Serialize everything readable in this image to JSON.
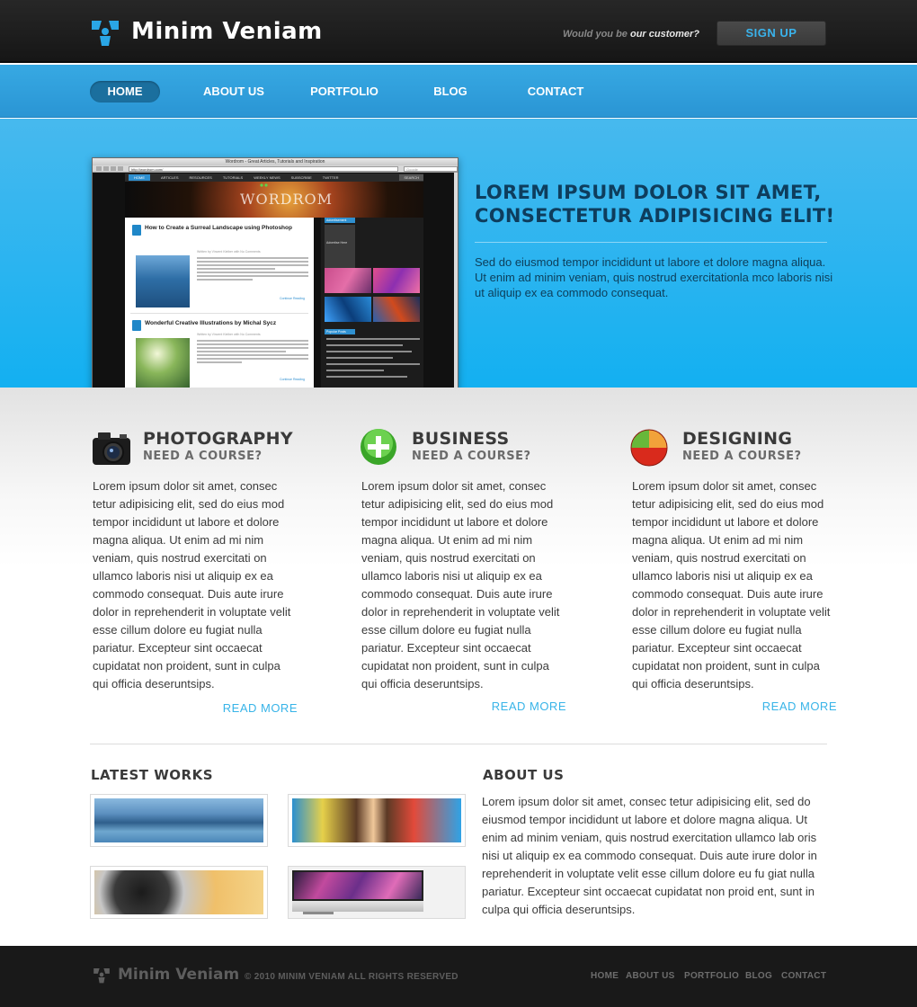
{
  "header": {
    "brand": "Minim Veniam",
    "cta_lead": "Would you be",
    "cta_strong": "our customer?",
    "signup_label": "SIGN UP"
  },
  "nav": {
    "items": [
      {
        "label": "HOME",
        "active": true
      },
      {
        "label": "ABOUT US"
      },
      {
        "label": "PORTFOLIO"
      },
      {
        "label": "BLOG"
      },
      {
        "label": "CONTACT"
      }
    ]
  },
  "hero": {
    "heading_line1": "LOREM IPSUM DOLOR SIT AMET,",
    "heading_line2": "CONSECTETUR ADIPISICING ELIT!",
    "body": "Sed do eiusmod tempor incididunt ut labore et dolore magna aliqua. Ut enim ad minim veniam, quis nostrud exercitationla mco laboris nisi ut aliquip ex ea commodo consequat.",
    "screenshot": {
      "window_title": "Wordrom - Great Articles, Tutorials and Inspiration",
      "url": "http://wordrom.com/",
      "search_placeholder": "Google",
      "nav": [
        "HOME",
        "ARTICLES",
        "RESOURCES",
        "TUTORIALS",
        "WEEKLY NEWS",
        "SUBSCRIBE",
        "TWITTER"
      ],
      "search_button": "SEARCH",
      "banner_word": "WORDROM",
      "post1_title": "How to Create a Surreal Landscape using Photoshop",
      "post1_meta": "Written by Vincent Kleiber with No Comments",
      "post2_title": "Wonderful Creative Illustrations by Michal Sycz",
      "post2_meta": "Written by Vincent Kleiber with No Comments",
      "continue": "Continue Reading",
      "sidebar_tab": "Advertisement",
      "sidebar_ad": "Advertise Here",
      "popular_tab": "Popular Posts"
    }
  },
  "features": [
    {
      "title": "PHOTOGRAPHY",
      "subtitle": "NEED A COURSE?",
      "icon": "camera-icon",
      "body": "Lorem ipsum dolor sit amet, consec tetur adipisicing elit, sed do eius mod tempor incididunt ut labore et dolore magna aliqua. Ut enim ad mi nim veniam, quis nostrud exercitati on ullamco laboris nisi ut aliquip ex ea commodo consequat. Duis aute irure dolor in reprehenderit in voluptate velit esse cillum dolore eu fugiat nulla pariatur. Excepteur sint occaecat cupidatat non proident, sunt in culpa qui officia deseruntsips.",
      "more": "READ MORE"
    },
    {
      "title": "BUSINESS",
      "subtitle": "NEED A COURSE?",
      "icon": "plus-circle-icon",
      "body": "Lorem ipsum dolor sit amet, consec tetur adipisicing elit, sed do eius mod tempor incididunt ut labore et dolore magna aliqua. Ut enim ad mi nim veniam, quis nostrud exercitati on ullamco laboris nisi ut aliquip ex ea commodo consequat. Duis aute irure dolor in reprehenderit in voluptate velit esse cillum dolore eu fugiat nulla pariatur. Excepteur sint occaecat cupidatat non proident, sunt in culpa qui officia deseruntsips.",
      "more": "READ MORE"
    },
    {
      "title": "DESIGNING",
      "subtitle": "NEED A COURSE?",
      "icon": "pie-chart-icon",
      "body": "Lorem ipsum dolor sit amet, consec tetur adipisicing elit, sed do eius mod tempor incididunt ut labore et dolore magna aliqua. Ut enim ad mi nim veniam, quis nostrud exercitati on ullamco laboris nisi ut aliquip ex ea commodo consequat. Duis aute irure dolor in reprehenderit in voluptate velit esse cillum dolore eu fugiat nulla pariatur. Excepteur sint occaecat cupidatat non proident, sunt in culpa qui officia deseruntsips.",
      "more": "READ MORE"
    }
  ],
  "latest_works": {
    "title": "LATEST WORKS",
    "items": [
      "mountain-lake-thumbnail",
      "colorful-portrait-thumbnail",
      "camera-lens-thumbnail",
      "imac-thumbnail"
    ]
  },
  "about": {
    "title": "ABOUT US",
    "body": "Lorem ipsum dolor sit amet, consec tetur adipisicing elit, sed do eiusmod tempor incididunt ut labore et dolore magna aliqua. Ut enim ad minim veniam, quis nostrud exercitation ullamco lab oris nisi ut aliquip ex ea commodo consequat. Duis aute irure dolor in reprehenderit in voluptate velit esse cillum dolore eu fu giat nulla pariatur. Excepteur sint occaecat cupidatat non proid ent, sunt in culpa qui officia deseruntsips."
  },
  "footer": {
    "brand": "Minim Veniam",
    "copyright": "© 2010 MINIM VENIAM ALL RIGHTS RESERVED",
    "nav": [
      "HOME",
      "ABOUT US",
      "PORTFOLIO",
      "BLOG",
      "CONTACT"
    ]
  },
  "colors": {
    "accent": "#38b4e8",
    "nav_bg": "#2a95d4",
    "hero_bg": "#13b0f1",
    "header_bg": "#1c1c1c",
    "heading_dark": "#0e3d5d"
  }
}
